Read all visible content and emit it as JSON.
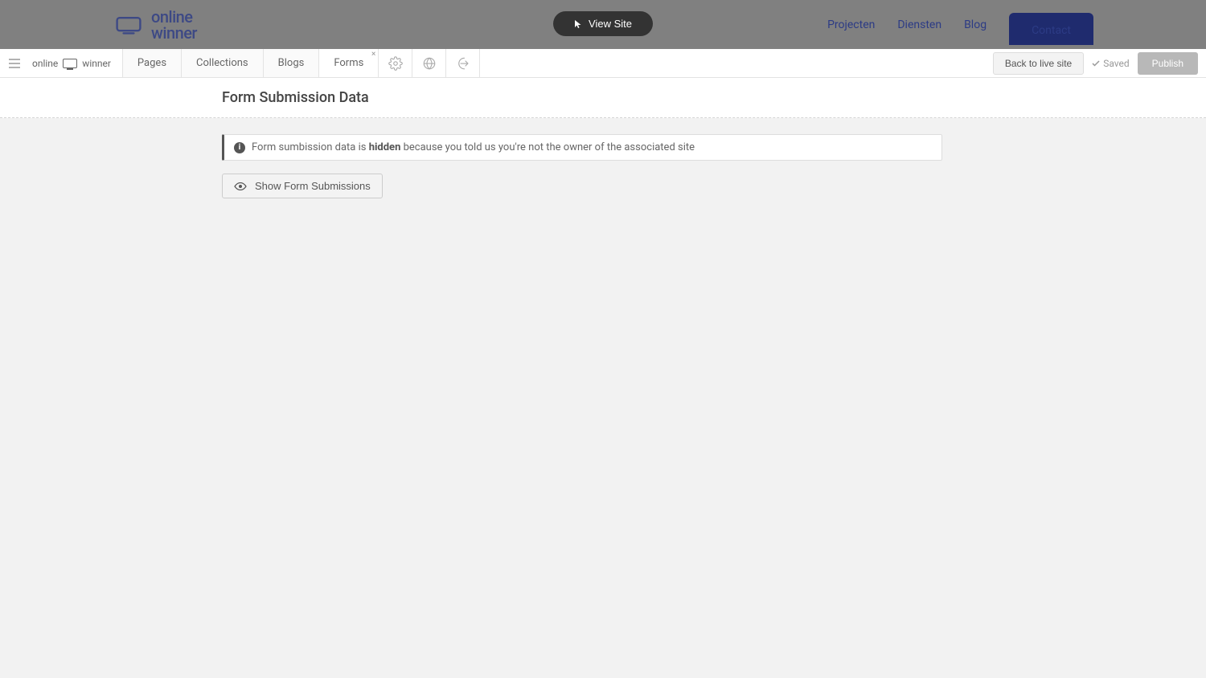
{
  "site_header": {
    "logo_text_1": "online",
    "logo_text_2": "winner",
    "view_site": "View Site",
    "nav": {
      "projecten": "Projecten",
      "diensten": "Diensten",
      "blog": "Blog",
      "contact": "Contact"
    }
  },
  "toolbar": {
    "brand_left": "online",
    "brand_right": "winner",
    "tabs": {
      "pages": "Pages",
      "collections": "Collections",
      "blogs": "Blogs",
      "forms": "Forms"
    },
    "back": "Back to live site",
    "saved": "Saved",
    "publish": "Publish"
  },
  "page": {
    "title": "Form Submission Data",
    "notice_pre": "Form sumbission data is ",
    "notice_strong": "hidden",
    "notice_post": " because you told us you're not the owner of the associated site",
    "show_btn": "Show Form Submissions"
  }
}
